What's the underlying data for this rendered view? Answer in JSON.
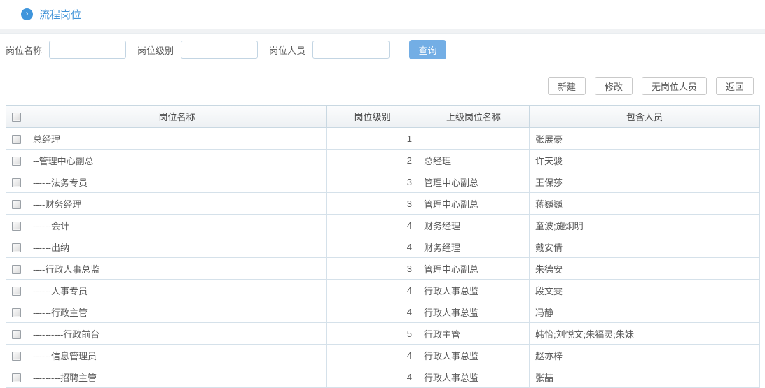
{
  "page": {
    "title": "流程岗位"
  },
  "colors": {
    "accent_blue": "#4193d7",
    "icon_blue": "#3f95dc",
    "query_button_blue": "#73aee5"
  },
  "icons": {
    "title_icon": "arrow-circle-icon",
    "title_glyph": "›"
  },
  "search": {
    "fields": [
      {
        "label": "岗位名称",
        "value": ""
      },
      {
        "label": "岗位级别",
        "value": ""
      },
      {
        "label": "岗位人员",
        "value": ""
      }
    ],
    "query_label": "查询"
  },
  "toolbar": {
    "new_label": "新建",
    "edit_label": "修改",
    "no_staff_label": "无岗位人员",
    "back_label": "返回"
  },
  "table": {
    "headers": [
      "岗位名称",
      "岗位级别",
      "上级岗位名称",
      "包含人员"
    ],
    "rows": [
      {
        "name": "总经理",
        "level": "1",
        "parent": "",
        "people": "张展豪"
      },
      {
        "name": "--管理中心副总",
        "level": "2",
        "parent": "总经理",
        "people": "许天骏"
      },
      {
        "name": "------法务专员",
        "level": "3",
        "parent": "管理中心副总",
        "people": "王保莎"
      },
      {
        "name": "----财务经理",
        "level": "3",
        "parent": "管理中心副总",
        "people": "蒋巍巍"
      },
      {
        "name": "------会计",
        "level": "4",
        "parent": "财务经理",
        "people": "童波;施炯明"
      },
      {
        "name": "------出纳",
        "level": "4",
        "parent": "财务经理",
        "people": "戴安倩"
      },
      {
        "name": "----行政人事总监",
        "level": "3",
        "parent": "管理中心副总",
        "people": "朱德安"
      },
      {
        "name": "------人事专员",
        "level": "4",
        "parent": "行政人事总监",
        "people": "段文雯"
      },
      {
        "name": "------行政主管",
        "level": "4",
        "parent": "行政人事总监",
        "people": "冯静"
      },
      {
        "name": "----------行政前台",
        "level": "5",
        "parent": "行政主管",
        "people": "韩怡;刘悦文;朱福灵;朱妹"
      },
      {
        "name": "------信息管理员",
        "level": "4",
        "parent": "行政人事总监",
        "people": "赵亦梓"
      },
      {
        "name": "---------招聘主管",
        "level": "4",
        "parent": "行政人事总监",
        "people": "张喆"
      }
    ]
  }
}
